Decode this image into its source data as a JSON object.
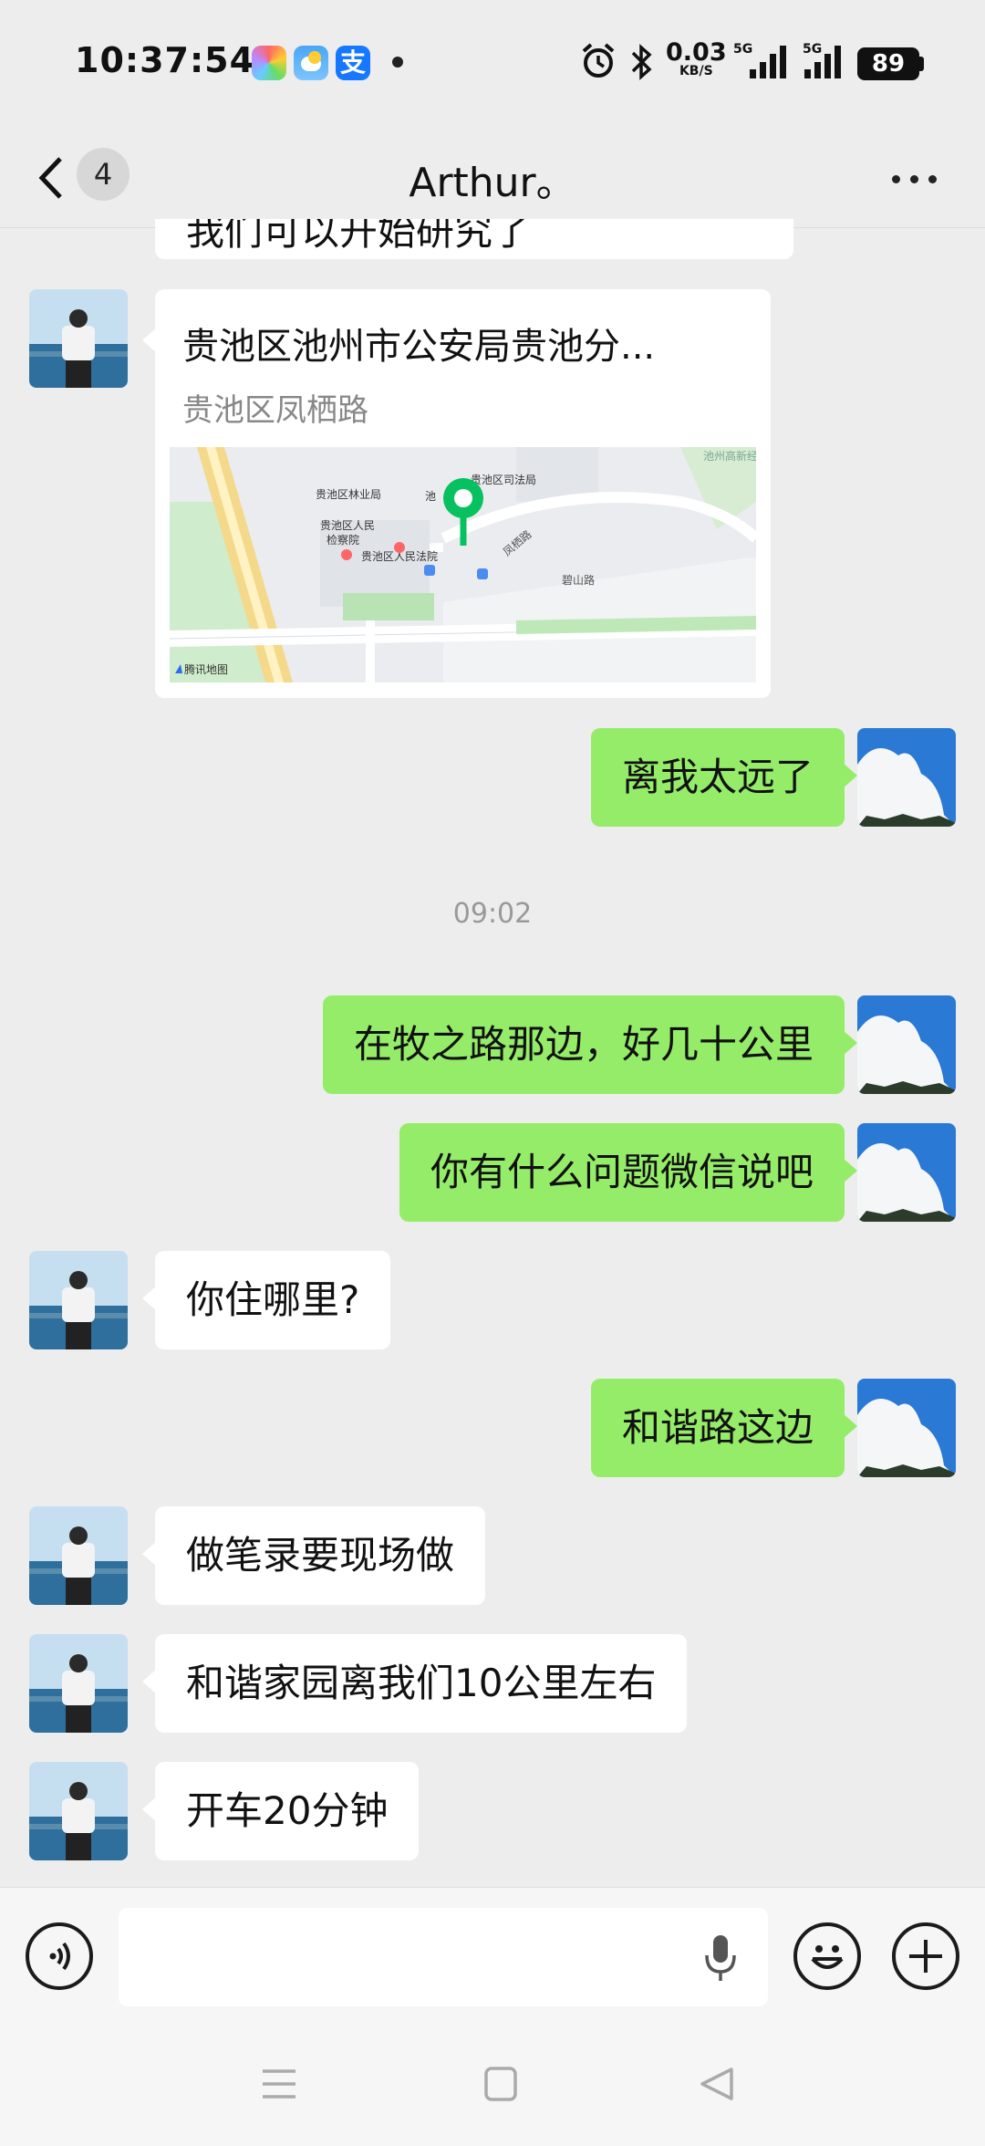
{
  "status_bar": {
    "time": "10:37:54",
    "net_speed": "0.03",
    "net_unit": "KB/S",
    "sim1": "5G",
    "sim2": "5G",
    "battery": "89"
  },
  "header": {
    "title": "Arthur。",
    "unread_count": "4"
  },
  "top_partial_text": "我们可以开始研究了",
  "location": {
    "title": "贵池区池州市公安局贵池分...",
    "address": "贵池区凤栖路",
    "map_labels": [
      "贵池区司法局",
      "贵池区林业局",
      "贵池区人民检察院",
      "贵池区人民法院",
      "凤栖路",
      "碧山路",
      "池州高新经济开发区",
      "池",
      "腾讯地图"
    ]
  },
  "messages": [
    {
      "dir": "out",
      "text": "离我太远了"
    },
    {
      "dir": "out",
      "text": "在牧之路那边，好几十公里"
    },
    {
      "dir": "out",
      "text": "你有什么问题微信说吧"
    },
    {
      "dir": "in",
      "text": "你住哪里?"
    },
    {
      "dir": "out",
      "text": "和谐路这边"
    },
    {
      "dir": "in",
      "text": "做笔录要现场做"
    },
    {
      "dir": "in",
      "text": "和谐家园离我们10公里左右"
    },
    {
      "dir": "in",
      "text": "开车20分钟"
    }
  ],
  "timestamp": "09:02",
  "icons": [
    "back-icon",
    "more-icon",
    "voice-icon",
    "mic-icon",
    "emoji-icon",
    "plus-icon",
    "menu-icon",
    "home-icon",
    "back-nav-icon"
  ],
  "colors": {
    "outgoing_bubble": "#95ec69",
    "incoming_bubble": "#ffffff",
    "background": "#ededed",
    "map_pin": "#07c160"
  }
}
